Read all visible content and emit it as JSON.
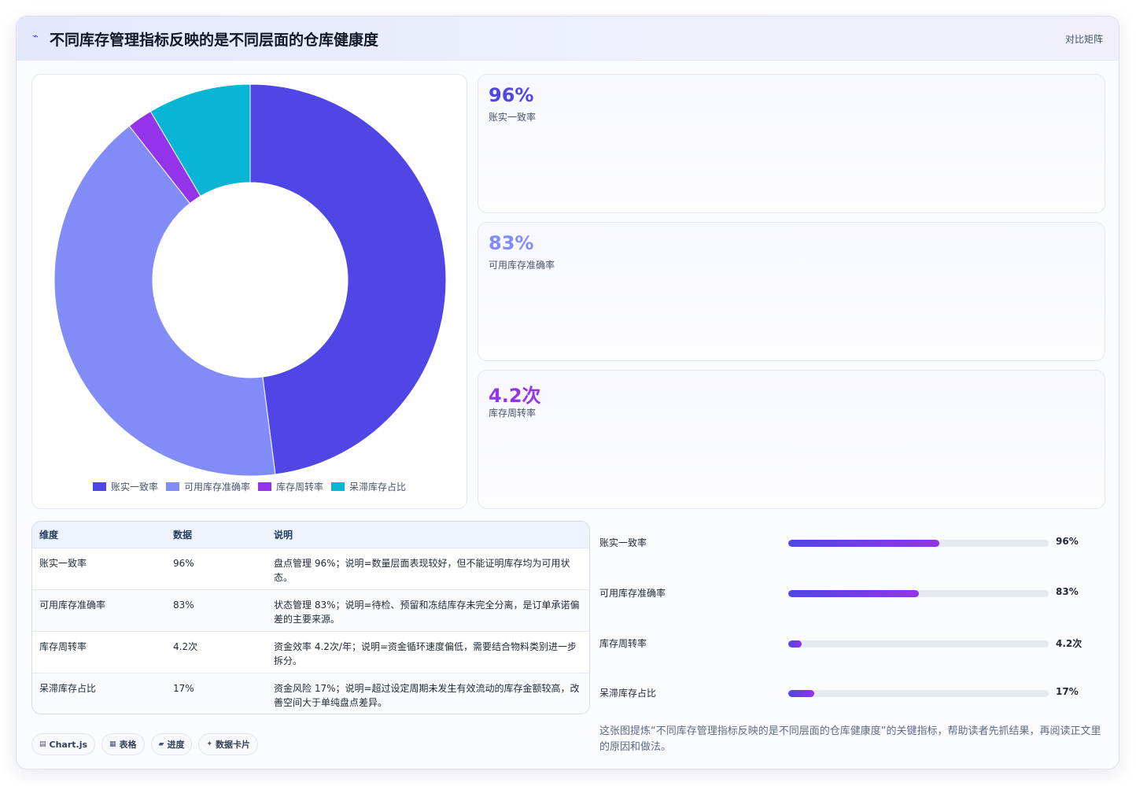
{
  "header": {
    "icon": "sparkline-icon",
    "title": "不同库存管理指标反映的是不同层面的仓库健康度",
    "right_link": "对比矩阵"
  },
  "chart_data": {
    "type": "pie",
    "donut": true,
    "categories": [
      "账实一致率",
      "可用库存准确率",
      "库存周转率",
      "呆滞库存占比"
    ],
    "values": [
      96,
      83,
      4.2,
      17
    ],
    "colors": [
      "#4f46e5",
      "#818cf8",
      "#9333ea",
      "#06b6d4"
    ],
    "legend_position": "bottom"
  },
  "stats": [
    {
      "value": "96%",
      "label": "账实一致率",
      "color": "#4f46e5"
    },
    {
      "value": "83%",
      "label": "可用库存准确率",
      "color": "#818cf8"
    },
    {
      "value": "4.2次",
      "label": "库存周转率",
      "color": "#9333ea"
    }
  ],
  "table": {
    "headers": [
      "维度",
      "数据",
      "说明"
    ],
    "rows": [
      [
        "账实一致率",
        "96%",
        "盘点管理 96%；说明=数量层面表现较好，但不能证明库存均为可用状态。"
      ],
      [
        "可用库存准确率",
        "83%",
        "状态管理 83%；说明=待检、预留和冻结库存未完全分离，是订单承诺偏差的主要来源。"
      ],
      [
        "库存周转率",
        "4.2次",
        "资金效率 4.2次/年；说明=资金循环速度偏低，需要结合物料类别进一步拆分。"
      ],
      [
        "呆滞库存占比",
        "17%",
        "资金风险 17%；说明=超过设定周期未发生有效流动的库存金额较高，改善空间大于单纯盘点差异。"
      ]
    ]
  },
  "progress": [
    {
      "label": "账实一致率",
      "value": "96%",
      "fill": 0.58
    },
    {
      "label": "可用库存准确率",
      "value": "83%",
      "fill": 0.5
    },
    {
      "label": "库存周转率",
      "value": "4.2次",
      "fill": 0.05
    },
    {
      "label": "呆滞库存占比",
      "value": "17%",
      "fill": 0.1
    }
  ],
  "tags": [
    {
      "icon": "chart-icon",
      "glyph": "▤",
      "label": "Chart.js"
    },
    {
      "icon": "table-icon",
      "glyph": "▦",
      "label": "表格"
    },
    {
      "icon": "progress-icon",
      "glyph": "▰",
      "label": "进度"
    },
    {
      "icon": "card-icon",
      "glyph": "✦",
      "label": "数据卡片"
    }
  ],
  "note": "这张图提炼“不同库存管理指标反映的是不同层面的仓库健康度”的关键指标，帮助读者先抓结果，再阅读正文里的原因和做法。"
}
